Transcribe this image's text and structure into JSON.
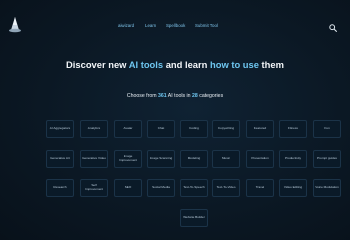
{
  "nav": {
    "links": [
      "aiwizard",
      "Learn",
      "Spellbook",
      "Submit Tool"
    ]
  },
  "hero": {
    "headline_parts": [
      "Discover new ",
      "AI tools",
      " and learn ",
      "how to use",
      " them"
    ],
    "sub_parts": [
      "Choose from ",
      "361",
      " AI tools in ",
      "28",
      " categories"
    ]
  },
  "categories": [
    "AI Aggregators",
    "Analytics",
    "Avatar",
    "Chat",
    "Coding",
    "Copywriting",
    "Featured",
    "Fitness",
    "Fun",
    "Generative Art",
    "Generative Video",
    "Image Improvement",
    "Image Scanning",
    "Modeling",
    "Music",
    "Presentation",
    "Productivity",
    "Prompt guides",
    "Research",
    "Self Improvement",
    "SEO",
    "Social Media",
    "Text-To-Speech",
    "Text-To-Video",
    "Travel",
    "Video Editing",
    "Voice Modulation",
    "Website Builder"
  ],
  "colors": {
    "accent": "#6ec6f0",
    "background": "#0b1622",
    "card_border": "#1b3348"
  },
  "icons": [
    "wizard-logo-icon",
    "search-icon"
  ]
}
